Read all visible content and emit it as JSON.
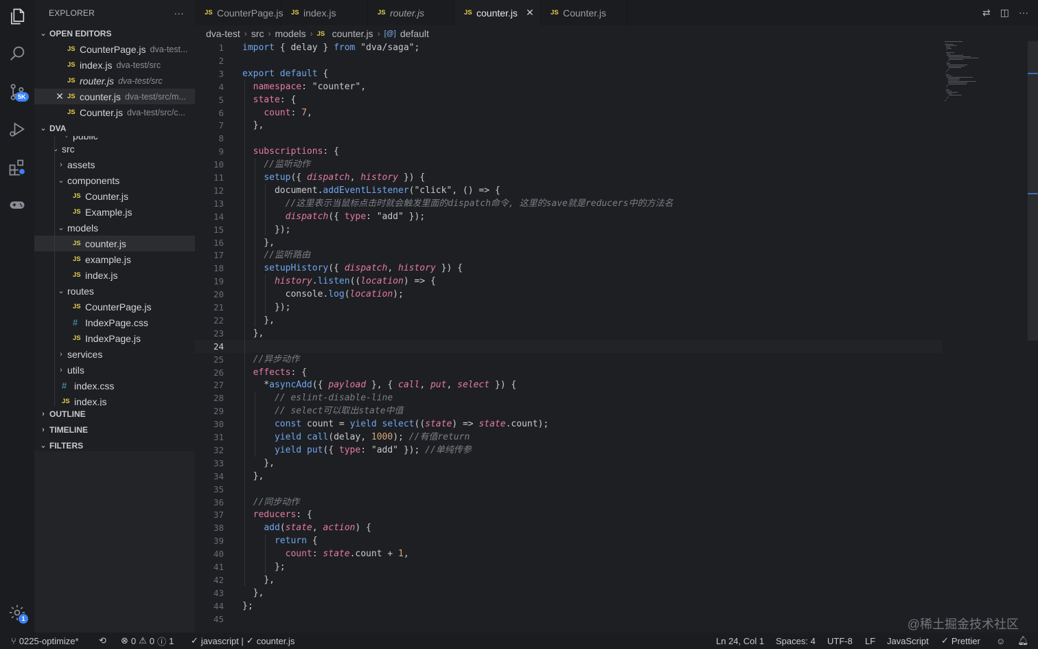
{
  "explorer": {
    "title": "EXPLORER",
    "more": "···",
    "open_editors_label": "OPEN EDITORS",
    "open_editors": [
      {
        "name": "CounterPage.js",
        "desc": "dva-test...",
        "italic": false,
        "active": false
      },
      {
        "name": "index.js",
        "desc": "dva-test/src",
        "italic": false,
        "active": false
      },
      {
        "name": "router.js",
        "desc": "dva-test/src",
        "italic": true,
        "active": false
      },
      {
        "name": "counter.js",
        "desc": "dva-test/src/m...",
        "italic": false,
        "active": true
      },
      {
        "name": "Counter.js",
        "desc": "dva-test/src/c...",
        "italic": false,
        "active": false
      }
    ],
    "project_label": "DVA",
    "tree_partial_top": "public",
    "tree": [
      {
        "type": "folder",
        "label": "src",
        "indent": 1,
        "open": true
      },
      {
        "type": "folder",
        "label": "assets",
        "indent": 2,
        "open": false
      },
      {
        "type": "folder",
        "label": "components",
        "indent": 2,
        "open": true
      },
      {
        "type": "js",
        "label": "Counter.js",
        "indent": 3
      },
      {
        "type": "js",
        "label": "Example.js",
        "indent": 3
      },
      {
        "type": "folder",
        "label": "models",
        "indent": 2,
        "open": true
      },
      {
        "type": "js",
        "label": "counter.js",
        "indent": 3,
        "selected": true
      },
      {
        "type": "js",
        "label": "example.js",
        "indent": 3
      },
      {
        "type": "js",
        "label": "index.js",
        "indent": 3
      },
      {
        "type": "folder",
        "label": "routes",
        "indent": 2,
        "open": true
      },
      {
        "type": "js",
        "label": "CounterPage.js",
        "indent": 3
      },
      {
        "type": "css",
        "label": "IndexPage.css",
        "indent": 3
      },
      {
        "type": "js",
        "label": "IndexPage.js",
        "indent": 3
      },
      {
        "type": "folder",
        "label": "services",
        "indent": 2,
        "open": false
      },
      {
        "type": "folder",
        "label": "utils",
        "indent": 2,
        "open": false
      },
      {
        "type": "css",
        "label": "index.css",
        "indent": 2
      },
      {
        "type": "js",
        "label": "index.js",
        "indent": 2
      }
    ],
    "outline_label": "OUTLINE",
    "timeline_label": "TIMELINE",
    "filters_label": "FILTERS"
  },
  "activity": {
    "scm_badge": "5K",
    "settings_badge": "1"
  },
  "tabs": [
    {
      "label": "CounterPage.js",
      "italic": false,
      "active": false
    },
    {
      "label": "index.js",
      "italic": false,
      "active": false
    },
    {
      "label": "router.js",
      "italic": true,
      "active": false
    },
    {
      "label": "counter.js",
      "italic": false,
      "active": true
    },
    {
      "label": "Counter.js",
      "italic": false,
      "active": false
    }
  ],
  "js_badge": "JS",
  "breadcrumb": {
    "parts": [
      "dva-test",
      "src",
      "models",
      "counter.js",
      "default"
    ],
    "symbol_icon": "[@]"
  },
  "editor": {
    "current_line": 24,
    "lines": [
      "import { delay } from \"dva/saga\";",
      "",
      "export default {",
      "  namespace: \"counter\",",
      "  state: {",
      "    count: 7,",
      "  },",
      "",
      "  subscriptions: {",
      "    //监听动作",
      "    setup({ dispatch, history }) {",
      "      document.addEventListener(\"click\", () => {",
      "        //这里表示当鼠标点击时就会触发里面的dispatch命令, 这里的save就是reducers中的方法名",
      "        dispatch({ type: \"add\" });",
      "      });",
      "    },",
      "    //监听路由",
      "    setupHistory({ dispatch, history }) {",
      "      history.listen((location) => {",
      "        console.log(location);",
      "      });",
      "    },",
      "  },",
      "",
      "  //异步动作",
      "  effects: {",
      "    *asyncAdd({ payload }, { call, put, select }) {",
      "      // eslint-disable-line",
      "      // select可以取出state中值",
      "      const count = yield select((state) => state.count);",
      "      yield call(delay, 1000); //有值return",
      "      yield put({ type: \"add\" }); //单纯传参",
      "    },",
      "  },",
      "",
      "  //同步动作",
      "  reducers: {",
      "    add(state, action) {",
      "      return {",
      "        count: state.count + 1,",
      "      };",
      "    },",
      "  },",
      "};",
      ""
    ]
  },
  "status": {
    "branch": "0225-optimize*",
    "errors": "0",
    "warnings": "0",
    "infos": "1",
    "lang_check": "javascript |",
    "file_check": "counter.js",
    "position": "Ln 24, Col 1",
    "spaces": "Spaces: 4",
    "encoding": "UTF-8",
    "eol": "LF",
    "language": "JavaScript",
    "prettier": "Prettier"
  },
  "watermark": "@稀土掘金技术社区",
  "colors": {
    "accent": "#3b82f6",
    "js_icon": "#e4cc50",
    "keyword": "#6fa7f2",
    "param": "#e57ba5",
    "number": "#d4a87a"
  }
}
